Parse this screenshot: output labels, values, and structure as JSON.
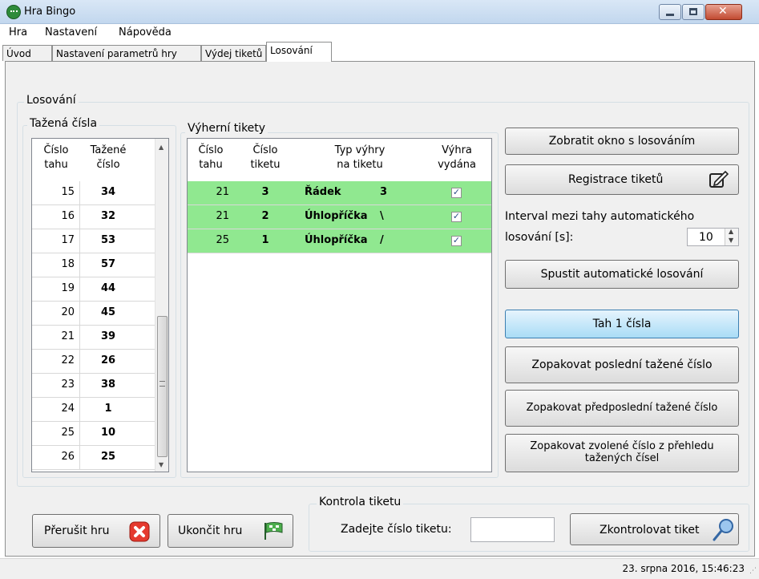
{
  "window": {
    "title": "Hra Bingo"
  },
  "menu": [
    "Hra",
    "Nastavení",
    "Nápověda"
  ],
  "tabs": [
    "Úvod",
    "Nastavení parametrů hry",
    "Výdej tiketů",
    "Losování"
  ],
  "active_tab": "Losování",
  "losovani": {
    "group_label": "Losování",
    "drawn": {
      "group_label": "Tažená čísla",
      "header_col1_line1": "Číslo",
      "header_col1_line2": "tahu",
      "header_col2_line1": "Tažené",
      "header_col2_line2": "číslo",
      "rows": [
        {
          "draw": "15",
          "number": "34"
        },
        {
          "draw": "16",
          "number": "32"
        },
        {
          "draw": "17",
          "number": "53"
        },
        {
          "draw": "18",
          "number": "57"
        },
        {
          "draw": "19",
          "number": "44"
        },
        {
          "draw": "20",
          "number": "45"
        },
        {
          "draw": "21",
          "number": "39"
        },
        {
          "draw": "22",
          "number": "26"
        },
        {
          "draw": "23",
          "number": "38"
        },
        {
          "draw": "24",
          "number": "1"
        },
        {
          "draw": "25",
          "number": "10"
        },
        {
          "draw": "26",
          "number": "25"
        }
      ],
      "scroll_position": 0.75
    },
    "winning": {
      "group_label": "Výherní tikety",
      "h1a": "Číslo",
      "h1b": "tahu",
      "h2a": "Číslo",
      "h2b": "tiketu",
      "h3a": "Typ výhry",
      "h3b": "na tiketu",
      "h4a": "Výhra",
      "h4b": "vydána",
      "rows": [
        {
          "draw": "21",
          "ticket": "3",
          "type": "Řádek",
          "type_detail": "3",
          "paid": true
        },
        {
          "draw": "21",
          "ticket": "2",
          "type": "Úhlopříčka",
          "type_detail": "\\",
          "paid": true
        },
        {
          "draw": "25",
          "ticket": "1",
          "type": "Úhlopříčka",
          "type_detail": "/",
          "paid": true
        }
      ],
      "check_glyph": "✓"
    },
    "buttons": {
      "show_window": "Zobratit okno s losováním",
      "register": "Registrace tiketů",
      "start_auto": "Spustit automatické losování",
      "draw_one": "Tah 1 čísla",
      "repeat_last": "Zopakovat poslední tažené číslo",
      "repeat_prelast": "Zopakovat předposlední tažené číslo",
      "repeat_chosen_line1": "Zopakovat zvolené číslo z přehledu",
      "repeat_chosen_line2": "tažených čísel"
    },
    "interval": {
      "label_line1": "Interval mezi tahy automatického",
      "label_line2": "losování [s]:",
      "value": "10"
    }
  },
  "bottom": {
    "interrupt": "Přerušit hru",
    "finish": "Ukončit hru",
    "check_group_label": "Kontrola tiketu",
    "ticket_label": "Zadejte číslo tiketu:",
    "ticket_value": "",
    "check_button": "Zkontrolovat tiket"
  },
  "status": {
    "datetime": "23. srpna 2016, 15:46:23"
  },
  "colors": {
    "win_row": "#90e890",
    "accent": "#a9dcf6",
    "close": "#c24b32"
  }
}
